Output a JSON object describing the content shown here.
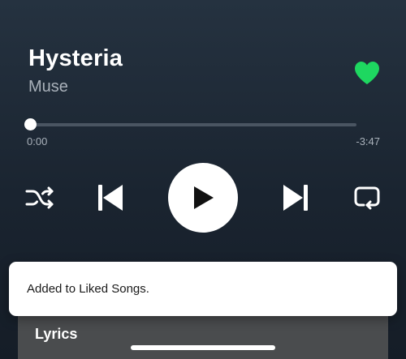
{
  "track": {
    "title": "Hysteria",
    "artist": "Muse",
    "liked": true,
    "like_icon": "heart-filled-icon"
  },
  "playback": {
    "elapsed": "0:00",
    "remaining": "-3:47",
    "progress_fraction": 0.0
  },
  "controls": {
    "shuffle_icon": "shuffle-icon",
    "previous_icon": "skip-previous-icon",
    "play_icon": "play-icon",
    "next_icon": "skip-next-icon",
    "repeat_icon": "repeat-icon"
  },
  "lyrics": {
    "label": "Lyrics"
  },
  "toast": {
    "message": "Added to Liked Songs."
  },
  "colors": {
    "accent_green": "#1ed760",
    "background": "#1a2430",
    "lyrics_card": "#4a4c4e",
    "toast_background": "#ffffff"
  }
}
